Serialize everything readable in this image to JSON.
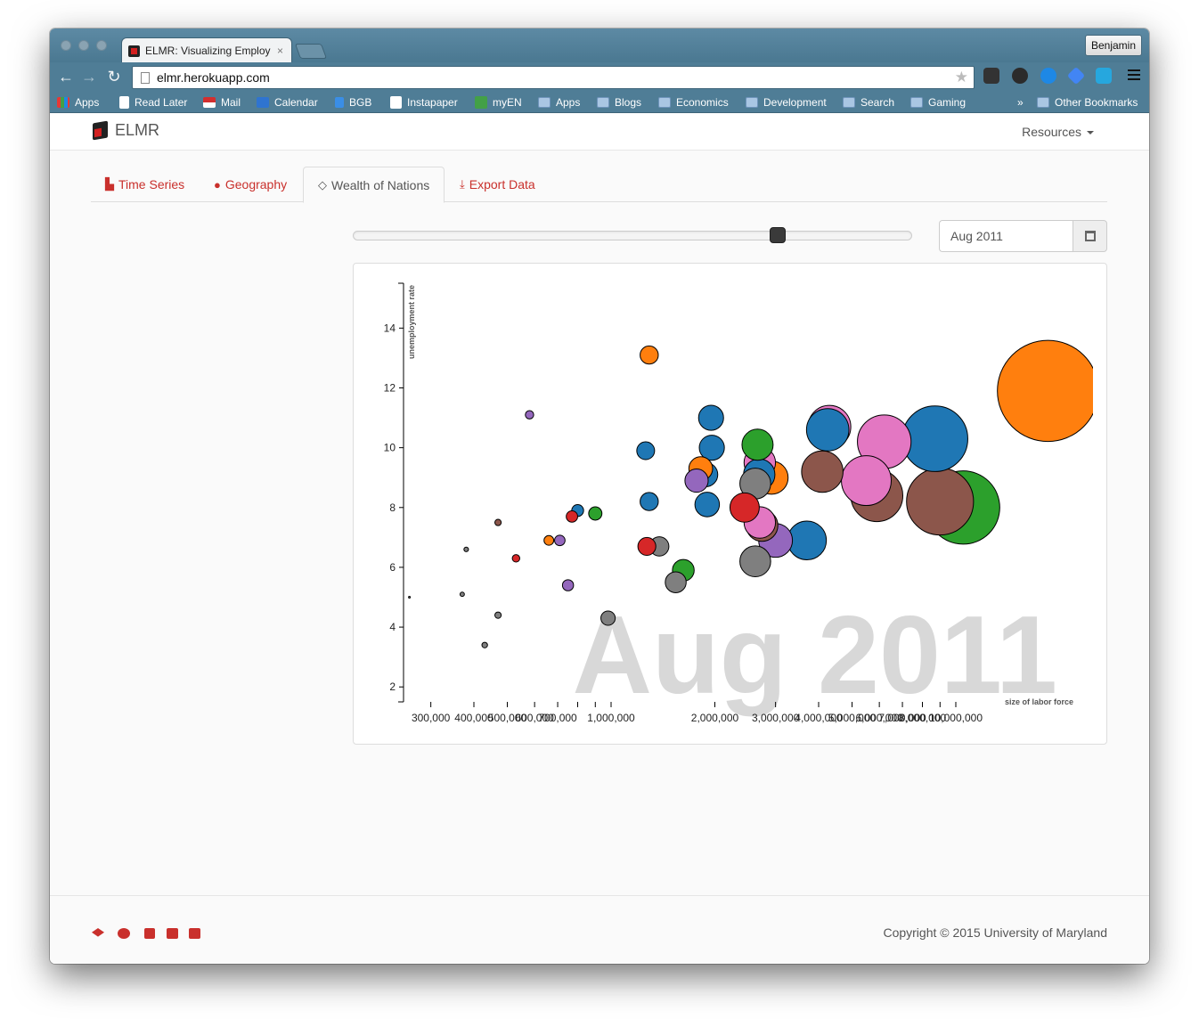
{
  "browser": {
    "tab_title": "ELMR: Visualizing Employ",
    "tab_close": "×",
    "profile_name": "Benjamin",
    "url": "elmr.herokuapp.com",
    "bookmarks": [
      "Apps",
      "Read Later",
      "Mail",
      "Calendar",
      "BGB",
      "Instapaper",
      "myEN",
      "Apps",
      "Blogs",
      "Economics",
      "Development",
      "Search",
      "Gaming"
    ],
    "overflow": "»",
    "other_bookmarks": "Other Bookmarks"
  },
  "navbar": {
    "brand": "ELMR",
    "resources": "Resources"
  },
  "tabs": [
    {
      "label": "Time Series",
      "icon": "area-chart-icon"
    },
    {
      "label": "Geography",
      "icon": "globe-icon"
    },
    {
      "label": "Wealth of Nations",
      "icon": "diamond-icon"
    },
    {
      "label": "Export Data",
      "icon": "download-icon"
    }
  ],
  "controls": {
    "date_value": "Aug 2011",
    "slider_fraction": 0.76
  },
  "chart_data": {
    "type": "scatter",
    "watermark": "Aug 2011",
    "xlabel": "size of labor force",
    "ylabel": "unemployment rate",
    "x_scale": "log",
    "xlim": [
      250000,
      25000000
    ],
    "ylim": [
      1.5,
      15.5
    ],
    "x_ticks": [
      300000,
      400000,
      500000,
      600000,
      700000,
      800000,
      900000,
      1000000,
      2000000,
      3000000,
      4000000,
      5000000,
      6000000,
      7000000,
      8000000,
      9000000,
      10000000
    ],
    "x_tick_labels": [
      "300,000",
      "400,000",
      "500,000",
      "600,000",
      "700,000",
      "",
      "",
      "1,000,000",
      "2,000,000",
      "3,000,000",
      "4,000,000",
      "5,000,000",
      "6,000,000",
      "7,000,000",
      "8,000,000",
      "",
      "10,000,000"
    ],
    "y_ticks": [
      2,
      4,
      6,
      8,
      10,
      12,
      14
    ],
    "points": [
      {
        "x": 260000,
        "y": 5.0,
        "c": "#7f7f7f"
      },
      {
        "x": 370000,
        "y": 5.1,
        "c": "#7f7f7f"
      },
      {
        "x": 380000,
        "y": 6.6,
        "c": "#7f7f7f"
      },
      {
        "x": 430000,
        "y": 3.4,
        "c": "#7f7f7f"
      },
      {
        "x": 470000,
        "y": 4.4,
        "c": "#7f7f7f"
      },
      {
        "x": 470000,
        "y": 7.5,
        "c": "#8c564b"
      },
      {
        "x": 530000,
        "y": 6.3,
        "c": "#d62728"
      },
      {
        "x": 580000,
        "y": 11.1,
        "c": "#9467bd"
      },
      {
        "x": 660000,
        "y": 6.9,
        "c": "#ff7f0e"
      },
      {
        "x": 710000,
        "y": 6.9,
        "c": "#9467bd"
      },
      {
        "x": 750000,
        "y": 5.4,
        "c": "#9467bd"
      },
      {
        "x": 770000,
        "y": 7.7,
        "c": "#d62728"
      },
      {
        "x": 800000,
        "y": 7.9,
        "c": "#1f77b4"
      },
      {
        "x": 900000,
        "y": 7.8,
        "c": "#2ca02c"
      },
      {
        "x": 980000,
        "y": 4.3,
        "c": "#7f7f7f"
      },
      {
        "x": 1260000,
        "y": 9.9,
        "c": "#1f77b4"
      },
      {
        "x": 1290000,
        "y": 13.1,
        "c": "#ff7f0e"
      },
      {
        "x": 1290000,
        "y": 8.2,
        "c": "#1f77b4"
      },
      {
        "x": 1270000,
        "y": 6.7,
        "c": "#d62728"
      },
      {
        "x": 1380000,
        "y": 6.7,
        "c": "#7f7f7f"
      },
      {
        "x": 1540000,
        "y": 5.5,
        "c": "#7f7f7f"
      },
      {
        "x": 1620000,
        "y": 5.9,
        "c": "#2ca02c"
      },
      {
        "x": 1770000,
        "y": 8.9,
        "c": "#9467bd"
      },
      {
        "x": 1820000,
        "y": 9.3,
        "c": "#ff7f0e"
      },
      {
        "x": 1880000,
        "y": 9.1,
        "c": "#1f77b4"
      },
      {
        "x": 1900000,
        "y": 8.1,
        "c": "#1f77b4"
      },
      {
        "x": 1950000,
        "y": 11.0,
        "c": "#1f77b4"
      },
      {
        "x": 1960000,
        "y": 10.0,
        "c": "#1f77b4"
      },
      {
        "x": 2440000,
        "y": 8.0,
        "c": "#d62728"
      },
      {
        "x": 2660000,
        "y": 10.1,
        "c": "#2ca02c"
      },
      {
        "x": 2700000,
        "y": 9.5,
        "c": "#e377c2"
      },
      {
        "x": 2620000,
        "y": 8.8,
        "c": "#7f7f7f"
      },
      {
        "x": 2690000,
        "y": 9.1,
        "c": "#1f77b4"
      },
      {
        "x": 2920000,
        "y": 9.0,
        "c": "#ff7f0e"
      },
      {
        "x": 2740000,
        "y": 7.4,
        "c": "#8c564b"
      },
      {
        "x": 2700000,
        "y": 7.5,
        "c": "#e377c2"
      },
      {
        "x": 2620000,
        "y": 6.2,
        "c": "#7f7f7f"
      },
      {
        "x": 3000000,
        "y": 6.9,
        "c": "#9467bd"
      },
      {
        "x": 3700000,
        "y": 6.9,
        "c": "#1f77b4"
      },
      {
        "x": 4100000,
        "y": 9.2,
        "c": "#8c564b"
      },
      {
        "x": 4300000,
        "y": 10.7,
        "c": "#e377c2"
      },
      {
        "x": 4250000,
        "y": 10.6,
        "c": "#1f77b4"
      },
      {
        "x": 5500000,
        "y": 8.9,
        "c": "#e377c2"
      },
      {
        "x": 5900000,
        "y": 8.4,
        "c": "#8c564b"
      },
      {
        "x": 6200000,
        "y": 10.2,
        "c": "#e377c2"
      },
      {
        "x": 8700000,
        "y": 10.3,
        "c": "#1f77b4"
      },
      {
        "x": 9000000,
        "y": 8.2,
        "c": "#8c564b"
      },
      {
        "x": 10500000,
        "y": 8.0,
        "c": "#2ca02c"
      },
      {
        "x": 18500000,
        "y": 11.9,
        "c": "#ff7f0e"
      }
    ]
  },
  "footer": {
    "copyright": "Copyright © 2015 University of Maryland",
    "icons": [
      "graduation-cap-icon",
      "cubes-icon",
      "book-icon",
      "github-icon",
      "trello-icon"
    ]
  }
}
